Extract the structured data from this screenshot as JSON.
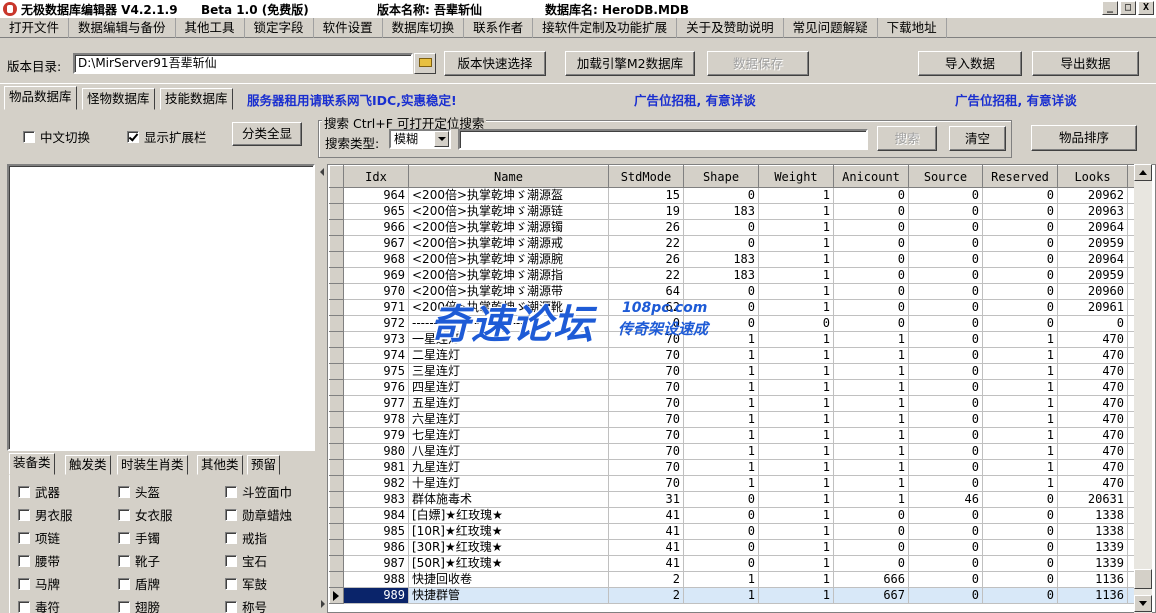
{
  "titlebar": {
    "app_name": "无极数据库编辑器 V4.2.1.9",
    "edition": "Beta 1.0 (免费版)",
    "version_label": "版本名称: 吾辈斩仙",
    "db_label": "数据库名: HeroDB.MDB",
    "minimize": "_",
    "maximize": "□",
    "close": "X"
  },
  "menu": [
    "打开文件",
    "数据编辑与备份",
    "其他工具",
    "锁定字段",
    "软件设置",
    "数据库切换",
    "联系作者",
    "接软件定制及功能扩展",
    "关于及赞助说明",
    "常见问题解疑",
    "下载地址"
  ],
  "toolbar": {
    "dir_label": "版本目录:",
    "dir_value": "D:\\MirServer91吾辈斩仙",
    "quick_select": "版本快速选择",
    "load_engine": "加载引擎M2数据库",
    "save_data": "数据保存",
    "import_data": "导入数据",
    "export_data": "导出数据"
  },
  "tabs": [
    "物品数据库",
    "怪物数据库",
    "技能数据库"
  ],
  "ads": {
    "server": "服务器租用请联系网飞IDC,实惠稳定!",
    "ad1": "广告位招租, 有意详谈",
    "ad2": "广告位招租, 有意详谈"
  },
  "options": {
    "chinese_toggle": "中文切换",
    "show_ext": "显示扩展栏",
    "show_all": "分类全显"
  },
  "search": {
    "legend": "搜索  Ctrl+F 可打开定位搜索",
    "type_label": "搜索类型:",
    "type_value": "模糊",
    "query": "",
    "search_btn": "搜索",
    "clear_btn": "清空",
    "sort_btn": "物品排序"
  },
  "category_tabs": [
    "装备类",
    "触发类",
    "时装生肖类",
    "其他类",
    "预留"
  ],
  "categories": [
    [
      "武器",
      "头盔",
      "斗笠面巾"
    ],
    [
      "男衣服",
      "女衣服",
      "勋章蜡烛"
    ],
    [
      "项链",
      "手镯",
      "戒指"
    ],
    [
      "腰带",
      "靴子",
      "宝石"
    ],
    [
      "马牌",
      "盾牌",
      "军鼓"
    ],
    [
      "毒符",
      "翅膀",
      "称号"
    ]
  ],
  "grid": {
    "columns": [
      "Idx",
      "Name",
      "StdMode",
      "Shape",
      "Weight",
      "Anicount",
      "Source",
      "Reserved",
      "Looks"
    ],
    "rows": [
      [
        "964",
        "<200倍>执掌乾坤ゞ潮源盔",
        "15",
        "0",
        "1",
        "0",
        "0",
        "0",
        "20962"
      ],
      [
        "965",
        "<200倍>执掌乾坤ゞ潮源链",
        "19",
        "183",
        "1",
        "0",
        "0",
        "0",
        "20963"
      ],
      [
        "966",
        "<200倍>执掌乾坤ゞ潮源镯",
        "26",
        "0",
        "1",
        "0",
        "0",
        "0",
        "20964"
      ],
      [
        "967",
        "<200倍>执掌乾坤ゞ潮源戒",
        "22",
        "0",
        "1",
        "0",
        "0",
        "0",
        "20959"
      ],
      [
        "968",
        "<200倍>执掌乾坤ゞ潮源腕",
        "26",
        "183",
        "1",
        "0",
        "0",
        "0",
        "20964"
      ],
      [
        "969",
        "<200倍>执掌乾坤ゞ潮源指",
        "22",
        "183",
        "1",
        "0",
        "0",
        "0",
        "20959"
      ],
      [
        "970",
        "<200倍>执掌乾坤ゞ潮源带",
        "64",
        "0",
        "1",
        "0",
        "0",
        "0",
        "20960"
      ],
      [
        "971",
        "<200倍>执掌乾坤ゞ潮源靴",
        "62",
        "0",
        "1",
        "0",
        "0",
        "0",
        "20961"
      ],
      [
        "972",
        "--------------------------",
        "0",
        "0",
        "0",
        "0",
        "0",
        "0",
        "0"
      ],
      [
        "973",
        "一星连灯",
        "70",
        "1",
        "1",
        "1",
        "0",
        "1",
        "470"
      ],
      [
        "974",
        "二星连灯",
        "70",
        "1",
        "1",
        "1",
        "0",
        "1",
        "470"
      ],
      [
        "975",
        "三星连灯",
        "70",
        "1",
        "1",
        "1",
        "0",
        "1",
        "470"
      ],
      [
        "976",
        "四星连灯",
        "70",
        "1",
        "1",
        "1",
        "0",
        "1",
        "470"
      ],
      [
        "977",
        "五星连灯",
        "70",
        "1",
        "1",
        "1",
        "0",
        "1",
        "470"
      ],
      [
        "978",
        "六星连灯",
        "70",
        "1",
        "1",
        "1",
        "0",
        "1",
        "470"
      ],
      [
        "979",
        "七星连灯",
        "70",
        "1",
        "1",
        "1",
        "0",
        "1",
        "470"
      ],
      [
        "980",
        "八星连灯",
        "70",
        "1",
        "1",
        "1",
        "0",
        "1",
        "470"
      ],
      [
        "981",
        "九星连灯",
        "70",
        "1",
        "1",
        "1",
        "0",
        "1",
        "470"
      ],
      [
        "982",
        "十星连灯",
        "70",
        "1",
        "1",
        "1",
        "0",
        "1",
        "470"
      ],
      [
        "983",
        "群体施毒术",
        "31",
        "0",
        "1",
        "1",
        "46",
        "0",
        "20631"
      ],
      [
        "984",
        "[白嫖]★红玫瑰★",
        "41",
        "0",
        "1",
        "0",
        "0",
        "0",
        "1338"
      ],
      [
        "985",
        "[10R]★红玫瑰★",
        "41",
        "0",
        "1",
        "0",
        "0",
        "0",
        "1338"
      ],
      [
        "986",
        "[30R]★红玫瑰★",
        "41",
        "0",
        "1",
        "0",
        "0",
        "0",
        "1339"
      ],
      [
        "987",
        "[50R]★红玫瑰★",
        "41",
        "0",
        "1",
        "0",
        "0",
        "0",
        "1339"
      ],
      [
        "988",
        "快捷回收卷",
        "2",
        "1",
        "1",
        "666",
        "0",
        "0",
        "1136"
      ],
      [
        "989",
        "快捷群管",
        "2",
        "1",
        "1",
        "667",
        "0",
        "0",
        "1136"
      ]
    ],
    "selected_index": 25
  },
  "watermark": {
    "main": "奇速论坛",
    "url": "108pc.com",
    "sub": "传奇架设速成"
  },
  "colors": {
    "face": "#d4d0c8",
    "selection": "#0a246a",
    "ad_text": "#1a2fd0",
    "watermark": "#1e5bd6"
  }
}
